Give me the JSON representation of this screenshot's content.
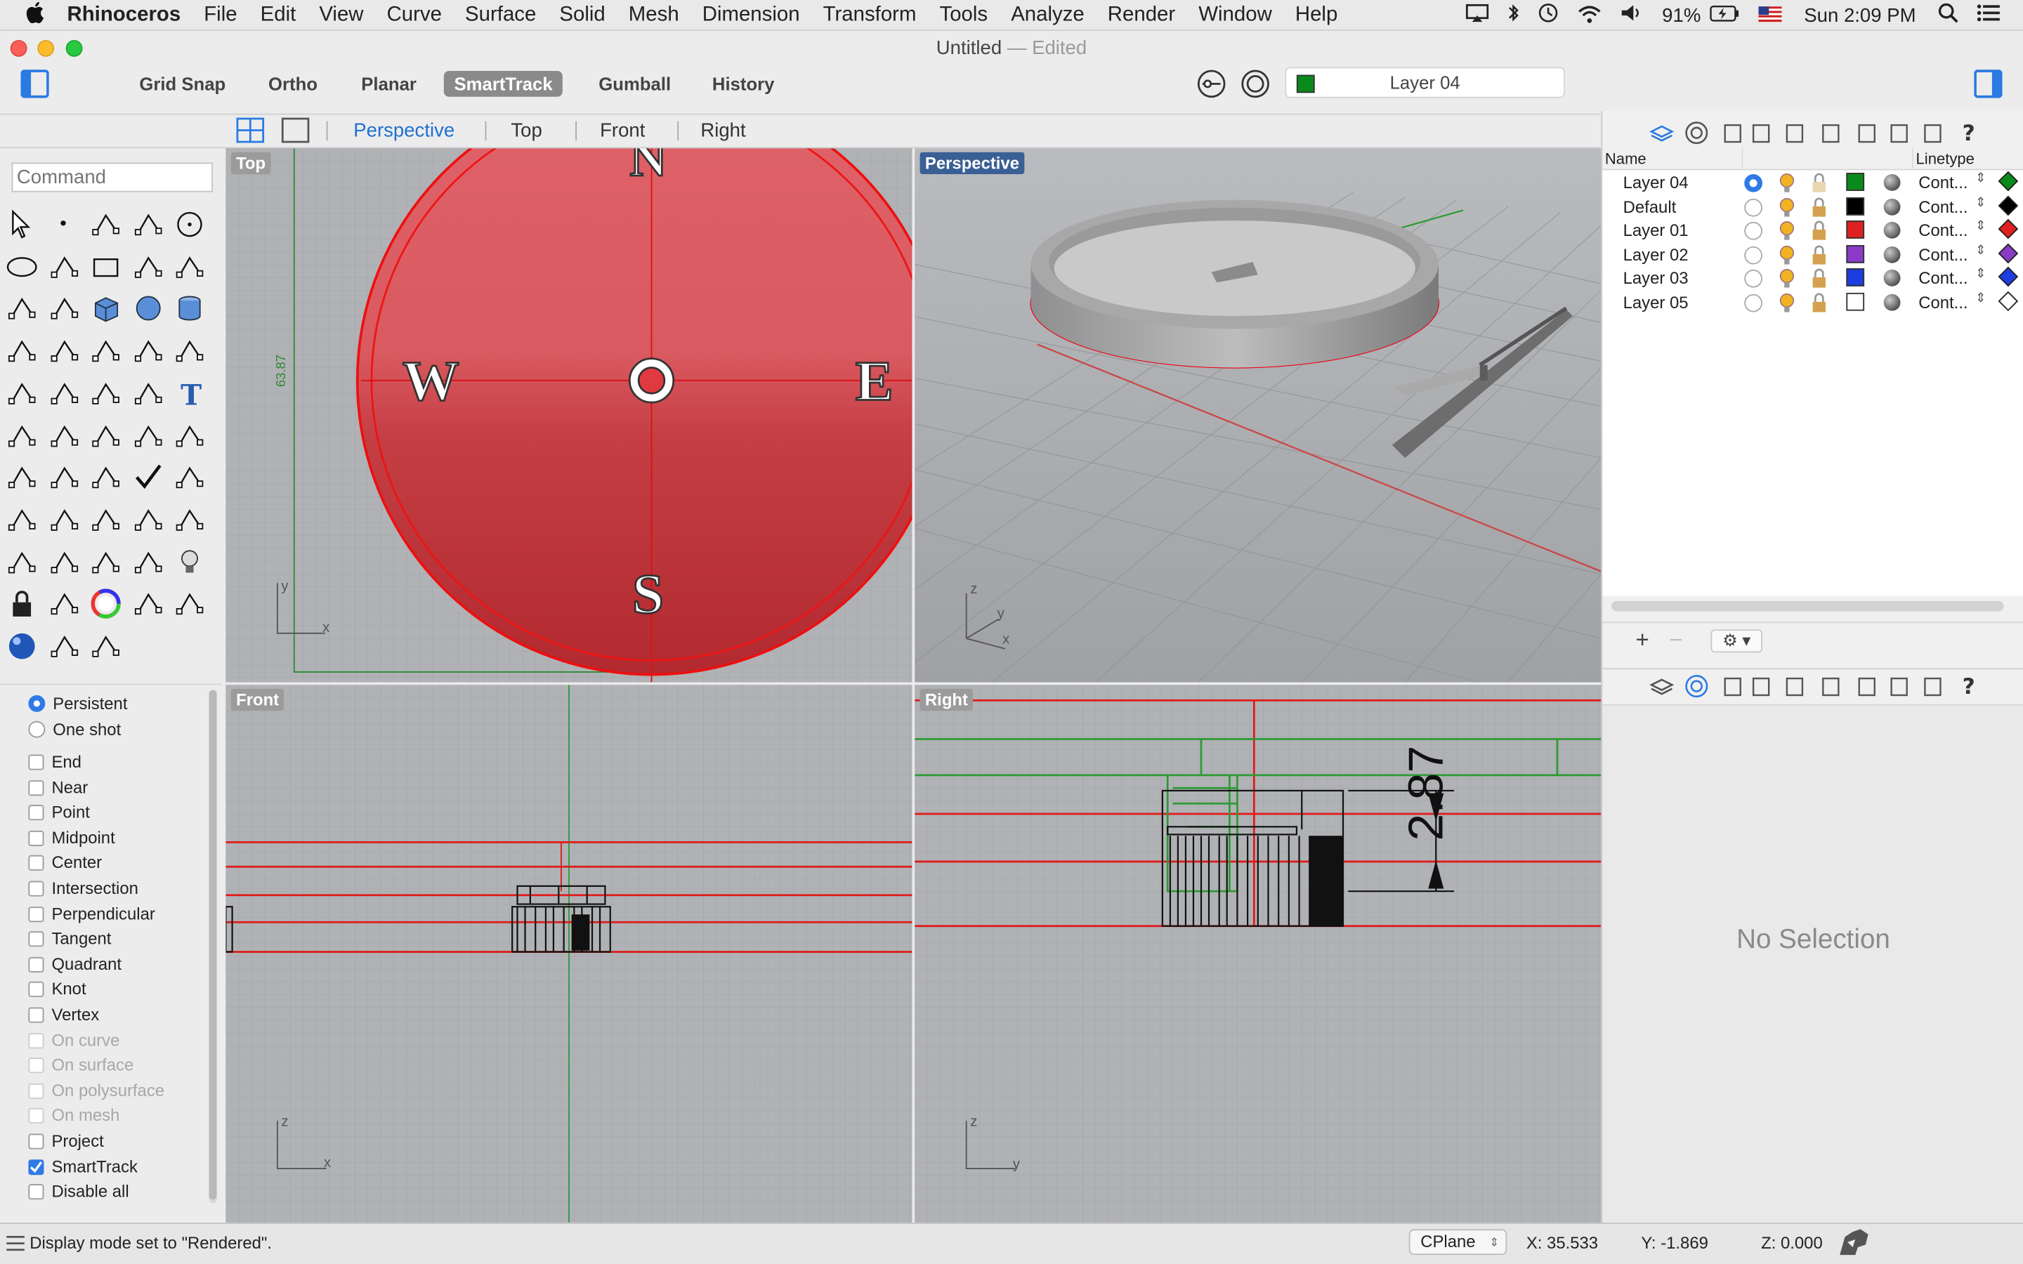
{
  "menubar": {
    "app": "Rhinoceros",
    "items": [
      "File",
      "Edit",
      "View",
      "Curve",
      "Surface",
      "Solid",
      "Mesh",
      "Dimension",
      "Transform",
      "Tools",
      "Analyze",
      "Render",
      "Window",
      "Help"
    ],
    "battery": "91%",
    "clock": "Sun 2:09 PM"
  },
  "window": {
    "title": "Untitled",
    "edited": "Edited"
  },
  "toolbar": {
    "toggles": [
      {
        "label": "Grid Snap",
        "on": false
      },
      {
        "label": "Ortho",
        "on": false
      },
      {
        "label": "Planar",
        "on": false
      },
      {
        "label": "SmartTrack",
        "on": true
      },
      {
        "label": "Gumball",
        "on": false
      },
      {
        "label": "History",
        "on": false
      }
    ],
    "current_layer": "Layer 04",
    "current_layer_color": "#0a8a1a"
  },
  "viewport_tabs": [
    {
      "label": "Perspective",
      "active": true
    },
    {
      "label": "Top",
      "active": false
    },
    {
      "label": "Front",
      "active": false
    },
    {
      "label": "Right",
      "active": false
    }
  ],
  "command": {
    "placeholder": "Command"
  },
  "osnap": {
    "mode": [
      {
        "label": "Persistent",
        "on": true
      },
      {
        "label": "One shot",
        "on": false
      }
    ],
    "items": [
      {
        "label": "End",
        "on": false,
        "enabled": true
      },
      {
        "label": "Near",
        "on": false,
        "enabled": true
      },
      {
        "label": "Point",
        "on": false,
        "enabled": true
      },
      {
        "label": "Midpoint",
        "on": false,
        "enabled": true
      },
      {
        "label": "Center",
        "on": false,
        "enabled": true
      },
      {
        "label": "Intersection",
        "on": false,
        "enabled": true
      },
      {
        "label": "Perpendicular",
        "on": false,
        "enabled": true
      },
      {
        "label": "Tangent",
        "on": false,
        "enabled": true
      },
      {
        "label": "Quadrant",
        "on": false,
        "enabled": true
      },
      {
        "label": "Knot",
        "on": false,
        "enabled": true
      },
      {
        "label": "Vertex",
        "on": false,
        "enabled": true
      },
      {
        "label": "On curve",
        "on": false,
        "enabled": false
      },
      {
        "label": "On surface",
        "on": false,
        "enabled": false
      },
      {
        "label": "On polysurface",
        "on": false,
        "enabled": false
      },
      {
        "label": "On mesh",
        "on": false,
        "enabled": false
      },
      {
        "label": "Project",
        "on": false,
        "enabled": true
      },
      {
        "label": "SmartTrack",
        "on": true,
        "enabled": true
      },
      {
        "label": "Disable all",
        "on": false,
        "enabled": true
      }
    ]
  },
  "viewports": {
    "top": {
      "label": "Top",
      "compass": {
        "n": "N",
        "s": "S",
        "e": "E",
        "w": "W"
      },
      "dimension": "63.87",
      "axes": {
        "x": "x",
        "y": "y"
      }
    },
    "perspective": {
      "label": "Perspective",
      "axes": {
        "x": "x",
        "y": "y",
        "z": "z"
      }
    },
    "front": {
      "label": "Front",
      "axes": {
        "x": "x",
        "z": "z"
      }
    },
    "right": {
      "label": "Right",
      "dimension": "2.87",
      "axes": {
        "y": "y",
        "z": "z"
      }
    }
  },
  "layers_panel": {
    "header_name": "Name",
    "header_linetype": "Linetype",
    "rows": [
      {
        "name": "Layer 04",
        "current": true,
        "color": "#0a8a1a",
        "linetype": "Cont...",
        "material": "#0a8a1a"
      },
      {
        "name": "Default",
        "current": false,
        "color": "#000000",
        "linetype": "Cont...",
        "material": "#000000"
      },
      {
        "name": "Layer 01",
        "current": false,
        "color": "#e02020",
        "linetype": "Cont...",
        "material": "#e02020"
      },
      {
        "name": "Layer 02",
        "current": false,
        "color": "#8a3cc8",
        "linetype": "Cont...",
        "material": "#8a3cc8"
      },
      {
        "name": "Layer 03",
        "current": false,
        "color": "#1c3ee0",
        "linetype": "Cont...",
        "material": "#1c3ee0"
      },
      {
        "name": "Layer 05",
        "current": false,
        "color": "#ffffff",
        "linetype": "Cont...",
        "material": "#ffffff"
      }
    ]
  },
  "properties_panel": {
    "empty_text": "No Selection"
  },
  "status": {
    "message": "Display mode set to \"Rendered\".",
    "cplane": "CPlane",
    "x": "X: 35.533",
    "y": "Y: -1.869",
    "z": "Z: 0.000"
  }
}
